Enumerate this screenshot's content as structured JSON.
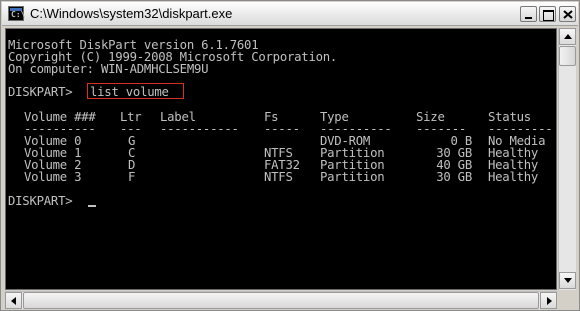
{
  "window": {
    "title": "C:\\Windows\\system32\\diskpart.exe",
    "icon": "console-app-icon",
    "controls": [
      "minimize-icon",
      "maximize-icon",
      "close-icon"
    ]
  },
  "console": {
    "text_color": "#c0c0c0",
    "background": "#000000",
    "highlight_color": "#d93025",
    "header_lines": [
      "Microsoft DiskPart version 6.1.7601",
      "Copyright (C) 1999-2008 Microsoft Corporation.",
      "On computer: WIN-ADMHCLSEM9U"
    ],
    "prompt": "DISKPART>",
    "command": "list volume",
    "table": {
      "headers": [
        "Volume ###",
        "Ltr",
        "Label",
        "Fs",
        "Type",
        "Size",
        "Status"
      ],
      "separators": [
        "----------",
        "---",
        "-----------",
        "-----",
        "----------",
        "-------",
        "---------"
      ],
      "rows": [
        [
          "Volume 0",
          "G",
          "",
          "",
          "DVD-ROM",
          "0 B",
          "No Media"
        ],
        [
          "Volume 1",
          "C",
          "",
          "NTFS",
          "Partition",
          "30 GB",
          "Healthy"
        ],
        [
          "Volume 2",
          "D",
          "",
          "FAT32",
          "Partition",
          "40 GB",
          "Healthy"
        ],
        [
          "Volume 3",
          "F",
          "",
          "NTFS",
          "Partition",
          "30 GB",
          "Healthy"
        ]
      ]
    },
    "final_prompt": "DISKPART>"
  }
}
